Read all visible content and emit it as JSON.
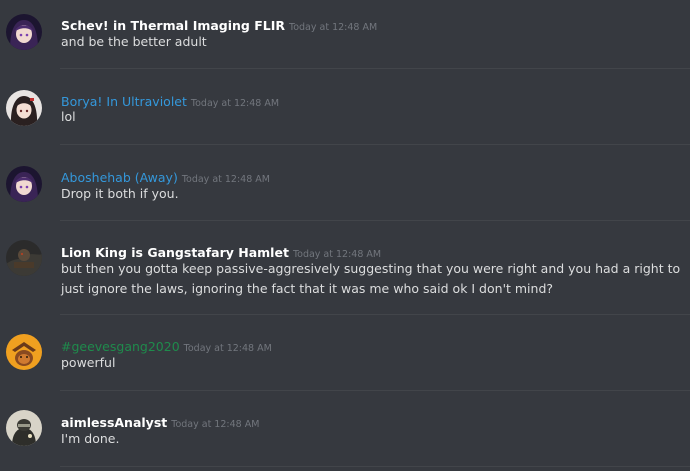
{
  "messages": [
    {
      "username": "Schev! in Thermal Imaging FLIR",
      "username_color": "#ffffff",
      "timestamp": "Today at 12:48 AM",
      "text": "and be the better adult",
      "avatar_icon": "purple-anime-girl-avatar"
    },
    {
      "username": "Borya! In Ultraviolet",
      "username_color": "#3498db",
      "timestamp": "Today at 12:48 AM",
      "text": "lol",
      "avatar_icon": "dark-hair-anime-girl-avatar"
    },
    {
      "username": "Aboshehab (Away)",
      "username_color": "#3498db",
      "timestamp": "Today at 12:48 AM",
      "text": "Drop it both if you.",
      "avatar_icon": "purple-anime-girl-avatar"
    },
    {
      "username": "Lion King is Gangstafary Hamlet",
      "username_color": "#ffffff",
      "timestamp": "Today at 12:48 AM",
      "text": "but then you gotta keep passive-aggresively suggesting that  you were right and you  had a right to just ignore the laws, ignoring the fact that it was me who said ok I don't mind?",
      "avatar_icon": "dark-scene-avatar"
    },
    {
      "username": "#geevesgang2020",
      "username_color": "#1f8b4c",
      "timestamp": "Today at 12:48 AM",
      "text": "powerful",
      "avatar_icon": "orange-hat-avatar"
    },
    {
      "username": "aimlessAnalyst",
      "username_color": "#ffffff",
      "timestamp": "Today at 12:48 AM",
      "text": "I'm done.",
      "avatar_icon": "soldier-avatar"
    }
  ]
}
